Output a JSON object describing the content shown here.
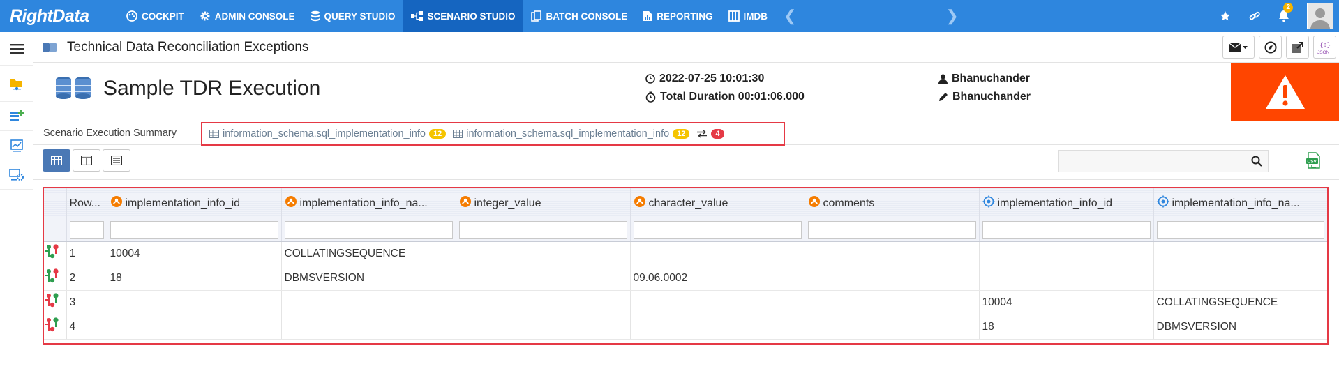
{
  "app": {
    "brand": "RightData"
  },
  "nav": {
    "items": [
      {
        "label": "COCKPIT",
        "icon": "palette-icon"
      },
      {
        "label": "ADMIN CONSOLE",
        "icon": "gear-icon"
      },
      {
        "label": "QUERY STUDIO",
        "icon": "database-icon"
      },
      {
        "label": "SCENARIO STUDIO",
        "icon": "flow-icon",
        "active": true
      },
      {
        "label": "BATCH CONSOLE",
        "icon": "batch-icon"
      },
      {
        "label": "REPORTING",
        "icon": "report-icon"
      },
      {
        "label": "IMDB",
        "icon": "columns-icon"
      }
    ],
    "notification_count": "2"
  },
  "titlebar": {
    "title": "Technical Data Reconciliation Exceptions"
  },
  "header": {
    "execution_name": "Sample TDR Execution",
    "datetime": "2022-07-25 10:01:30",
    "duration": "Total Duration 00:01:06.000",
    "user_run": "Bhanuchander",
    "user_edit": "Bhanuchander",
    "status_color": "#ff4500"
  },
  "tabs": {
    "summary_label": "Scenario Execution Summary",
    "source": {
      "label": "information_schema.sql_implementation_info",
      "count": "12"
    },
    "target": {
      "label": "information_schema.sql_implementation_info",
      "count": "12"
    },
    "diff_count": "4"
  },
  "grid": {
    "columns": [
      {
        "label": "Row...",
        "icon": ""
      },
      {
        "label": "implementation_info_id",
        "icon": "source-icon"
      },
      {
        "label": "implementation_info_na...",
        "icon": "source-icon"
      },
      {
        "label": "integer_value",
        "icon": "source-icon"
      },
      {
        "label": "character_value",
        "icon": "source-icon"
      },
      {
        "label": "comments",
        "icon": "source-icon"
      },
      {
        "label": "implementation_info_id",
        "icon": "target-icon"
      },
      {
        "label": "implementation_info_na...",
        "icon": "target-icon"
      }
    ],
    "rows": [
      {
        "indicator": "source-only",
        "cells": [
          "1",
          "10004",
          "COLLATINGSEQUENCE",
          "",
          "",
          "",
          "",
          ""
        ]
      },
      {
        "indicator": "source-only",
        "cells": [
          "2",
          "18",
          "DBMSVERSION",
          "",
          "09.06.0002",
          "",
          "",
          ""
        ]
      },
      {
        "indicator": "target-only",
        "cells": [
          "3",
          "",
          "",
          "",
          "",
          "",
          "10004",
          "COLLATINGSEQUENCE"
        ]
      },
      {
        "indicator": "target-only",
        "cells": [
          "4",
          "",
          "",
          "",
          "",
          "",
          "18",
          "DBMSVERSION"
        ]
      }
    ]
  }
}
